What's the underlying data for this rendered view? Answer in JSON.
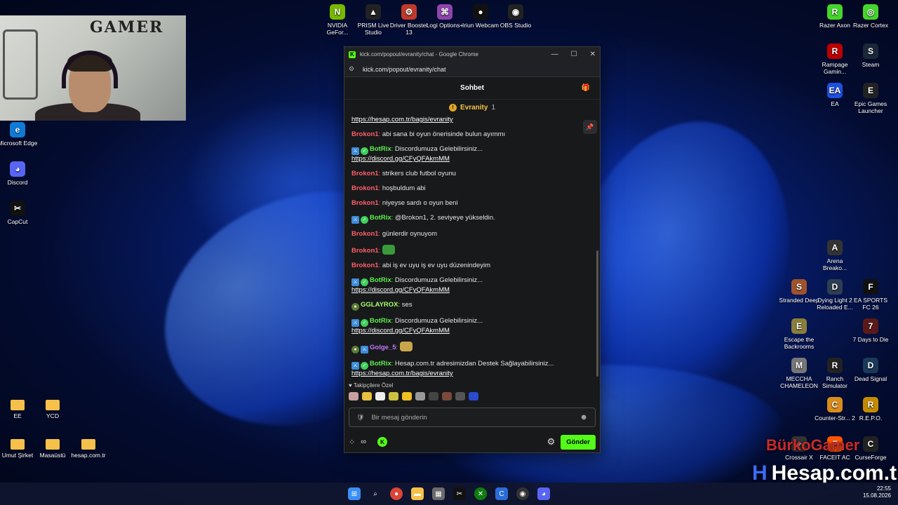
{
  "desktop": {
    "icons_top": [
      {
        "label": "NVIDIA GeFor...",
        "color": "#76b900",
        "glyph": "N"
      },
      {
        "label": "PRISM Live Studio",
        "color": "#222",
        "glyph": "▲"
      },
      {
        "label": "Driver Booster 13",
        "color": "#c0392b",
        "glyph": "⚙"
      },
      {
        "label": "Logi Options+",
        "color": "#8e44ad",
        "glyph": "⌘"
      },
      {
        "label": "Iriun Webcam",
        "color": "#111",
        "glyph": "●"
      },
      {
        "label": "OBS Studio",
        "color": "#222",
        "glyph": "◉"
      }
    ],
    "icons_left": [
      {
        "label": "Microsoft Edge",
        "color": "#0f7bd6",
        "glyph": "e"
      },
      {
        "label": "Discord",
        "color": "#5865f2",
        "glyph": "◕"
      },
      {
        "label": "CapCut",
        "color": "#111",
        "glyph": "✂"
      }
    ],
    "folders": [
      {
        "label": "EE"
      },
      {
        "label": "YCD"
      },
      {
        "label": "Umut Şirket"
      },
      {
        "label": "Masaüstü"
      },
      {
        "label": "hesap.com.tr"
      }
    ],
    "icons_right": [
      {
        "label": "Razer Axon",
        "color": "#44d62c",
        "glyph": "R"
      },
      {
        "label": "Razer Cortex",
        "color": "#44d62c",
        "glyph": "◎"
      },
      {
        "label": "Rampage Gamin...",
        "color": "#b00",
        "glyph": "R"
      },
      {
        "label": "Steam",
        "color": "#1b2838",
        "glyph": "S"
      },
      {
        "label": "EA",
        "color": "#1f4fe0",
        "glyph": "EA"
      },
      {
        "label": "Epic Games Launcher",
        "color": "#222",
        "glyph": "E"
      },
      {
        "label": "Arena Breako...",
        "color": "#333",
        "glyph": "A"
      },
      {
        "label": "Stranded Deep",
        "color": "#a0522d",
        "glyph": "S"
      },
      {
        "label": "Dying Light 2 Reloaded E...",
        "color": "#2c3e50",
        "glyph": "D"
      },
      {
        "label": "EA SPORTS FC 26",
        "color": "#111",
        "glyph": "F"
      },
      {
        "label": "Escape the Backrooms",
        "color": "#8b7d3a",
        "glyph": "E"
      },
      {
        "label": "7 Days to Die",
        "color": "#5a1a1a",
        "glyph": "7"
      },
      {
        "label": "MECCHA CHAMELEON",
        "color": "#777",
        "glyph": "M"
      },
      {
        "label": "Ranch Simulator",
        "color": "#222",
        "glyph": "R"
      },
      {
        "label": "Dead Signal",
        "color": "#1a3a5a",
        "glyph": "D"
      },
      {
        "label": "Counter-Str... 2",
        "color": "#d98c1b",
        "glyph": "C"
      },
      {
        "label": "R.E.P.O.",
        "color": "#c58b00",
        "glyph": "R"
      },
      {
        "label": "Crossair X",
        "color": "#333",
        "glyph": "+"
      },
      {
        "label": "FACEIT AC",
        "color": "#ff5500",
        "glyph": "F"
      },
      {
        "label": "CurseForge",
        "color": "#222",
        "glyph": "C"
      }
    ]
  },
  "webcam": {
    "wall_text": "GAMER"
  },
  "window": {
    "title": "kick.com/popout/evranity/chat - Google Chrome",
    "url": "kick.com/popout/evranity/chat",
    "controls": [
      "—",
      "☐",
      "✕"
    ]
  },
  "chat": {
    "header": "Sohbet",
    "pinned_user": "Evranity",
    "pinned_count": "1",
    "messages": [
      {
        "type": "link_only",
        "link": "https://hesap.com.tr/bagis/evranity"
      },
      {
        "user": "Brokon1",
        "cls": "brokon",
        "text": "abi sana bi oyun önerisinde bulun ayımmı"
      },
      {
        "user": "BotRix",
        "cls": "botrix",
        "badges": true,
        "text": "Discordumuza Gelebilirsiniz...",
        "link": "https://discord.gg/CFyQFAkmMM"
      },
      {
        "user": "Brokon1",
        "cls": "brokon",
        "text": "strikers club futbol oyunu"
      },
      {
        "user": "Brokon1",
        "cls": "brokon",
        "text": "hoşbuldum abi"
      },
      {
        "user": "Brokon1",
        "cls": "brokon",
        "text": "niyeyse sardı o oyun beni"
      },
      {
        "user": "BotRix",
        "cls": "botrix",
        "badges": true,
        "text": "@Brokon1, 2. seviyeye yükseldin."
      },
      {
        "user": "Brokon1",
        "cls": "brokon",
        "text": "günlerdir oynuyom"
      },
      {
        "user": "Brokon1",
        "cls": "brokon",
        "text": "",
        "emote": "#3a9a3a"
      },
      {
        "user": "Brokon1",
        "cls": "brokon",
        "text": "abi iş ev uyu iş ev uyu düzenindeyim"
      },
      {
        "user": "BotRix",
        "cls": "botrix",
        "badges": true,
        "text": "Discordumuza Gelebilirsiniz...",
        "link": "https://discord.gg/CFyQFAkmMM"
      },
      {
        "user": "GGLAYROX",
        "cls": "gglay",
        "sub": true,
        "text": "ses"
      },
      {
        "user": "BotRix",
        "cls": "botrix",
        "badges": true,
        "text": "Discordumuza Gelebilirsiniz...",
        "link": "https://discord.gg/CFyQFAkmMM"
      },
      {
        "user": "Golge_5",
        "cls": "golge",
        "sub": true,
        "mod": true,
        "text": "",
        "emote": "#c9a64a"
      },
      {
        "user": "BotRix",
        "cls": "botrix",
        "badges": true,
        "text": "Hesap.com.tr adresimizdan Destek Sağlayabilirsiniz...",
        "link": "https://hesap.com.tr/bagis/evranity"
      }
    ],
    "emote_section_label": "Takipçilere Özel",
    "emote_colors": [
      "#c8a0a0",
      "#e8c040",
      "#eee",
      "#d0c040",
      "#f0c020",
      "#999",
      "#444",
      "#7a4a3a",
      "#555",
      "#2a4ad0"
    ],
    "input_placeholder": "Bir mesaj gönderin",
    "send_label": "Gönder"
  },
  "watermark": {
    "text": "Hesap.com.tr",
    "banner": "BürkoGamer"
  },
  "tray": {
    "time": "22:55",
    "date": "15.08.2026"
  }
}
